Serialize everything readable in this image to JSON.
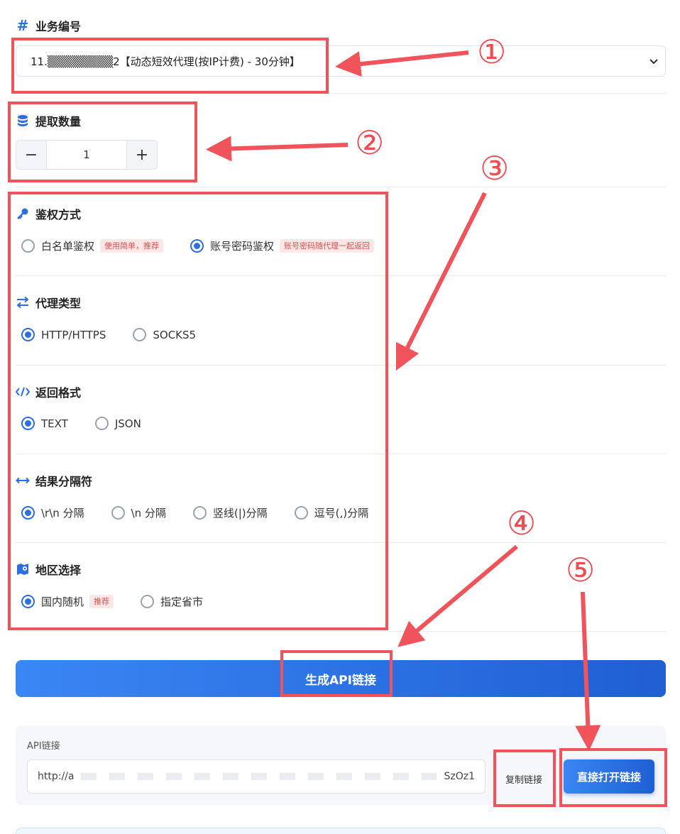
{
  "business": {
    "label": "业务编号",
    "icon": "hash-icon",
    "selected": "11.▒▒▒▒▒▒▒▒2【动态短效代理(按IP计费) - 30分钟】"
  },
  "quantity": {
    "label": "提取数量",
    "icon": "database-icon",
    "value": "1",
    "minus": "−",
    "plus": "+"
  },
  "auth": {
    "label": "鉴权方式",
    "icon": "key-icon",
    "options": [
      {
        "label": "白名单鉴权",
        "tag": "使用简单，推荐",
        "checked": false
      },
      {
        "label": "账号密码鉴权",
        "tag": "账号密码随代理一起返回",
        "checked": true
      }
    ]
  },
  "proxy_type": {
    "label": "代理类型",
    "icon": "exchange-icon",
    "options": [
      {
        "label": "HTTP/HTTPS",
        "checked": true
      },
      {
        "label": "SOCKS5",
        "checked": false
      }
    ]
  },
  "format": {
    "label": "返回格式",
    "icon": "code-icon",
    "options": [
      {
        "label": "TEXT",
        "checked": true
      },
      {
        "label": "JSON",
        "checked": false
      }
    ]
  },
  "separator": {
    "label": "结果分隔符",
    "icon": "arrows-h-icon",
    "options": [
      {
        "label": "\\r\\n 分隔",
        "checked": true
      },
      {
        "label": "\\n 分隔",
        "checked": false
      },
      {
        "label": "竖线(|)分隔",
        "checked": false
      },
      {
        "label": "逗号(,)分隔",
        "checked": false
      }
    ]
  },
  "region": {
    "label": "地区选择",
    "icon": "map-pin-icon",
    "options": [
      {
        "label": "国内随机",
        "tag": "推荐",
        "checked": true
      },
      {
        "label": "指定省市",
        "checked": false
      }
    ]
  },
  "generate_button": "生成API链接",
  "api": {
    "label": "API链接",
    "url_start": "http://a",
    "url_end": "SzOz1",
    "copy": "复制链接",
    "open": "直接打开链接"
  },
  "annotations": {
    "n1": "①",
    "n2": "②",
    "n3": "③",
    "n4": "④",
    "n5": "⑤",
    "color": "#f0535a"
  }
}
